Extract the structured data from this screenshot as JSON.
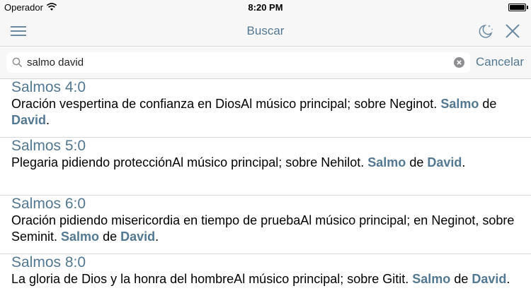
{
  "status_bar": {
    "carrier": "Operador",
    "time": "8:20 PM",
    "battery_level": 1.0
  },
  "nav_bar": {
    "title": "Buscar"
  },
  "search": {
    "query": "salmo david",
    "cancel_label": "Cancelar"
  },
  "results": [
    {
      "reference": "Salmos 4:0",
      "parts": [
        "Oración vespertina de confianza en DiosAl músico principal; sobre Neginot. ",
        "Salmo",
        " de ",
        "David",
        "."
      ]
    },
    {
      "reference": "Salmos 5:0",
      "parts": [
        "Plegaria pidiendo protecciónAl músico principal; sobre Nehilot. ",
        "Salmo",
        " de ",
        "David",
        "."
      ]
    },
    {
      "reference": "Salmos 6:0",
      "parts": [
        "Oración pidiendo misericordia en tiempo de pruebaAl músico principal; en Neginot, sobre Seminit. ",
        "Salmo",
        " de ",
        "David",
        "."
      ]
    },
    {
      "reference": "Salmos 8:0",
      "parts": [
        "La gloria de Dios y la honra del hombreAl músico principal; sobre Gitit. ",
        "Salmo",
        " de ",
        "David",
        "."
      ]
    }
  ],
  "colors": {
    "accent": "#537891",
    "bar_background": "#f7f7f7",
    "separator": "#d9d9d9"
  },
  "icons": {
    "menu": "hamburger-icon",
    "night_mode": "moon-stars-icon",
    "close": "close-icon",
    "search": "search-icon",
    "clear": "clear-circle-icon",
    "wifi": "wifi-icon",
    "battery": "battery-icon"
  }
}
